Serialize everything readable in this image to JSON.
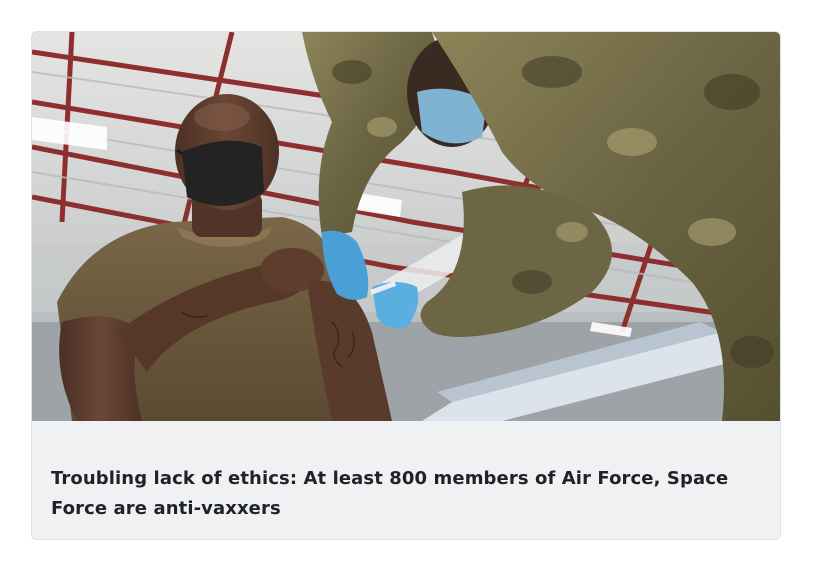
{
  "article": {
    "headline": "Troubling lack of ethics: At least 800 members of Air Force, Space Force are anti-vaxxers",
    "image": {
      "icon": "photo-soldier-vaccination",
      "colors": {
        "shirt": "#6b5a3f",
        "skin": "#5a3b2b",
        "mask": "#232323",
        "glove": "#4a9fd6",
        "camo_light": "#a79a6a",
        "camo_dark": "#4f4a33",
        "rafter": "#8e2f2f",
        "ceiling": "#d8d9d6"
      }
    }
  }
}
